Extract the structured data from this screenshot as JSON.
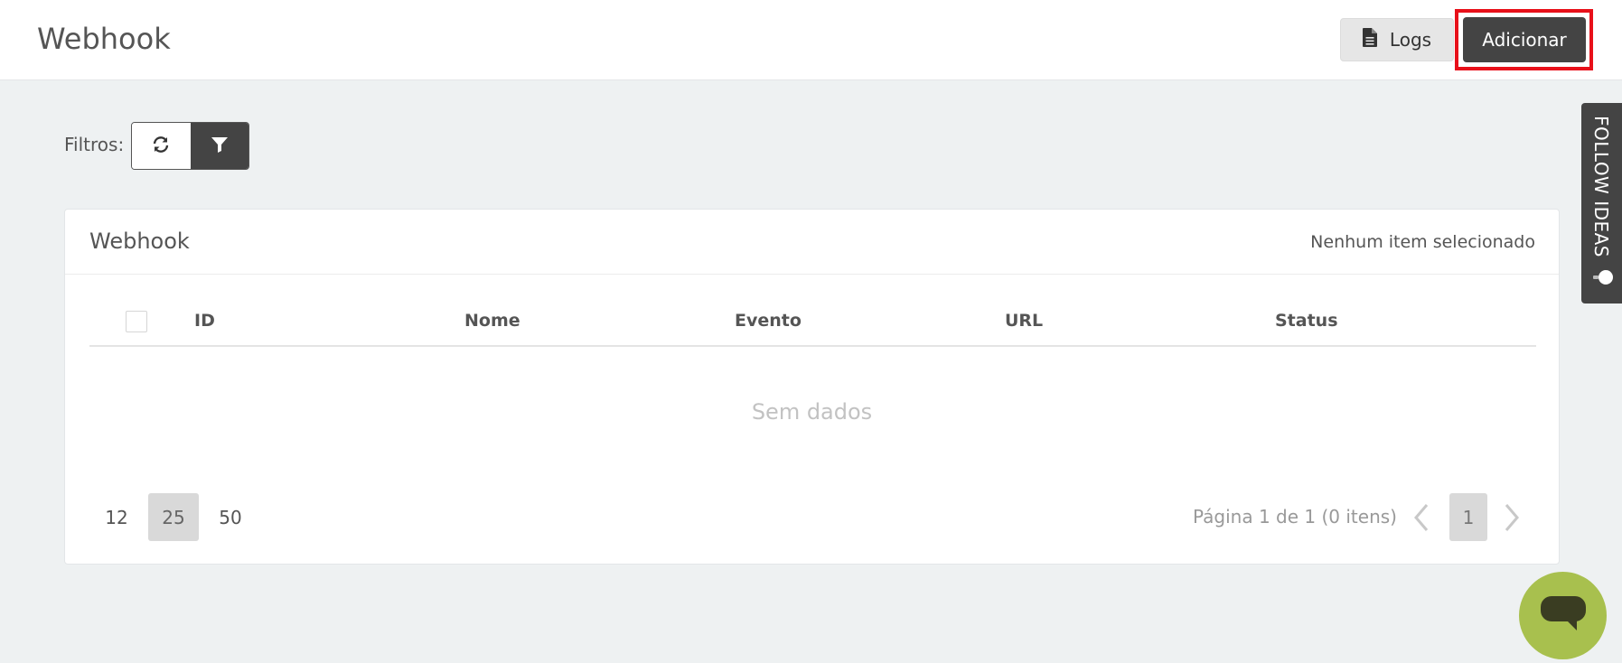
{
  "header": {
    "title": "Webhook",
    "logs_label": "Logs",
    "add_label": "Adicionar"
  },
  "filters": {
    "label": "Filtros:"
  },
  "card": {
    "title": "Webhook",
    "selection_status": "Nenhum item selecionado"
  },
  "table": {
    "columns": [
      "ID",
      "Nome",
      "Evento",
      "URL",
      "Status"
    ],
    "empty_text": "Sem dados"
  },
  "pagination": {
    "page_sizes": [
      "12",
      "25",
      "50"
    ],
    "active_page_size": "25",
    "info": "Página 1 de 1 (0 itens)",
    "current_page": "1"
  },
  "side_tab": {
    "label": "FOLLOW IDEAS"
  },
  "colors": {
    "dark_button": "#444444",
    "highlight": "#e8101a",
    "chat": "#a8c04e",
    "background": "#eef1f2"
  }
}
